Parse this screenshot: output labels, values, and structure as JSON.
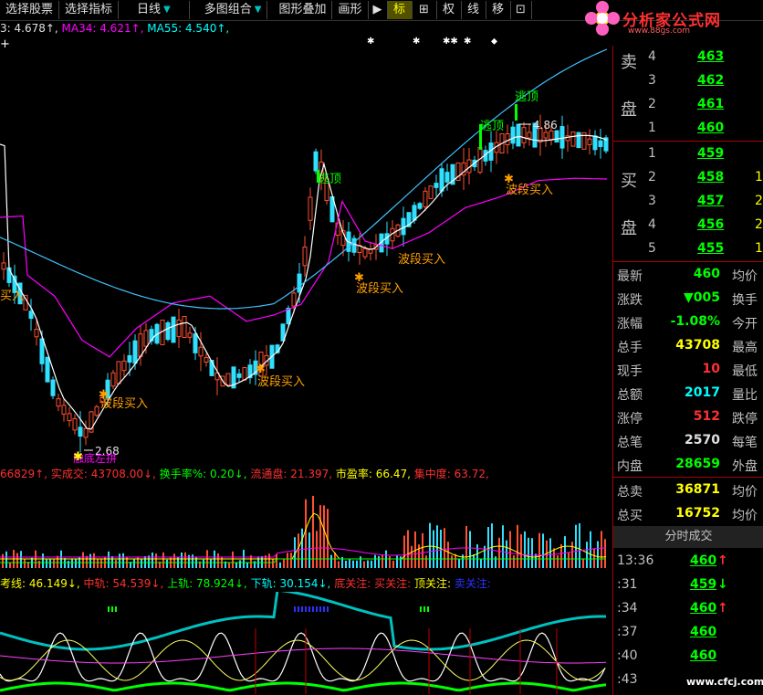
{
  "toolbar": {
    "items": [
      {
        "label": "选择股票",
        "arrow": ""
      },
      {
        "label": "选择指标",
        "arrow": ""
      },
      {
        "label": "日线",
        "arrow": "▼"
      },
      {
        "label": "多图组合",
        "arrow": "▼"
      },
      {
        "label": "图形叠加",
        "arrow": ""
      },
      {
        "label": "画形",
        "arrow": ""
      }
    ],
    "icons": [
      "▶",
      "标",
      "⊞",
      "权",
      "线",
      "移",
      "⊡"
    ]
  },
  "logo": {
    "text": "分析家公式网",
    "url": "www.88gs.com"
  },
  "ma_line": {
    "ma_prefix": "3: 4.678↑,",
    "ma34": "MA34: 4.621↑,",
    "ma55": "MA55: 4.540↑,"
  },
  "chart_labels": {
    "escape": [
      "逃顶",
      "逃顶",
      "逃顶"
    ],
    "buy": [
      "波段买入",
      "波段买入",
      "波段买入",
      "波段买入",
      "波段买入"
    ],
    "peak_value": "4.86",
    "low_value": "2.68",
    "low_label": "触底左拼",
    "left_label": "买入"
  },
  "volume_line": {
    "a": "66829↑,",
    "b": "实成交: 43708.00↓,",
    "c": "换手率%: 0.20↓,",
    "d": "流通盘: 21.397,",
    "e": "市盈率: 66.47,",
    "f": "集中度: 63.72,"
  },
  "bottom_line": {
    "a": "考线: 46.149↓,",
    "b": "中轨: 54.539↓,",
    "c": "上轨: 78.924↓,",
    "d": "下轨: 30.154↓,",
    "e": "底关注:",
    "f": "买关注:",
    "g": "顶关注:",
    "h": "卖关注:"
  },
  "order_book": {
    "sell_chars": [
      "卖",
      "盘"
    ],
    "buy_chars": [
      "买",
      "盘"
    ],
    "sells": [
      {
        "idx": "4",
        "price": "463",
        "vol": ""
      },
      {
        "idx": "3",
        "price": "462",
        "vol": ""
      },
      {
        "idx": "2",
        "price": "461",
        "vol": ""
      },
      {
        "idx": "1",
        "price": "460",
        "vol": ""
      }
    ],
    "buys": [
      {
        "idx": "1",
        "price": "459",
        "vol": ""
      },
      {
        "idx": "2",
        "price": "458",
        "vol": "1"
      },
      {
        "idx": "3",
        "price": "457",
        "vol": "2"
      },
      {
        "idx": "4",
        "price": "456",
        "vol": "2"
      },
      {
        "idx": "5",
        "price": "455",
        "vol": "1"
      }
    ]
  },
  "quote": [
    {
      "label": "最新",
      "value": "460",
      "color": "#00ff00",
      "extra": "均价"
    },
    {
      "label": "涨跌",
      "value": "▼005",
      "color": "#00ff00",
      "extra": "换手"
    },
    {
      "label": "涨幅",
      "value": "-1.08%",
      "color": "#00ff00",
      "extra": "今开"
    },
    {
      "label": "总手",
      "value": "43708",
      "color": "#ffff00",
      "extra": "最高"
    },
    {
      "label": "现手",
      "value": "10",
      "color": "#ff3030",
      "extra": "最低"
    },
    {
      "label": "总额",
      "value": "2017",
      "color": "#00ffff",
      "extra": "量比"
    },
    {
      "label": "涨停",
      "value": "512",
      "color": "#ff3030",
      "extra": "跌停"
    },
    {
      "label": "总笔",
      "value": "2570",
      "color": "#e0e0e0",
      "extra": "每笔"
    },
    {
      "label": "内盘",
      "value": "28659",
      "color": "#00ff00",
      "extra": "外盘"
    }
  ],
  "totals": [
    {
      "label": "总卖",
      "value": "36871",
      "color": "#ffff00",
      "extra": "均价"
    },
    {
      "label": "总买",
      "value": "16752",
      "color": "#ffff00",
      "extra": "均价"
    }
  ],
  "ticks_header": "分时成交",
  "ticks": [
    {
      "time": "13:36",
      "price": "460",
      "arrow": "↑",
      "color": "#00ff00",
      "acolor": "#ff3030"
    },
    {
      "time": ":31",
      "price": "459",
      "arrow": "↓",
      "color": "#00ff00",
      "acolor": "#00ff00"
    },
    {
      "time": ":34",
      "price": "460",
      "arrow": "↑",
      "color": "#00ff00",
      "acolor": "#ff3030"
    },
    {
      "time": ":37",
      "price": "460",
      "arrow": "",
      "color": "#00ff00",
      "acolor": ""
    },
    {
      "time": ":40",
      "price": "460",
      "arrow": "",
      "color": "#00ff00",
      "acolor": ""
    },
    {
      "time": ":43",
      "price": "",
      "arrow": "",
      "color": "#00ff00",
      "acolor": ""
    }
  ],
  "watermark": "www.cfcj.com"
}
